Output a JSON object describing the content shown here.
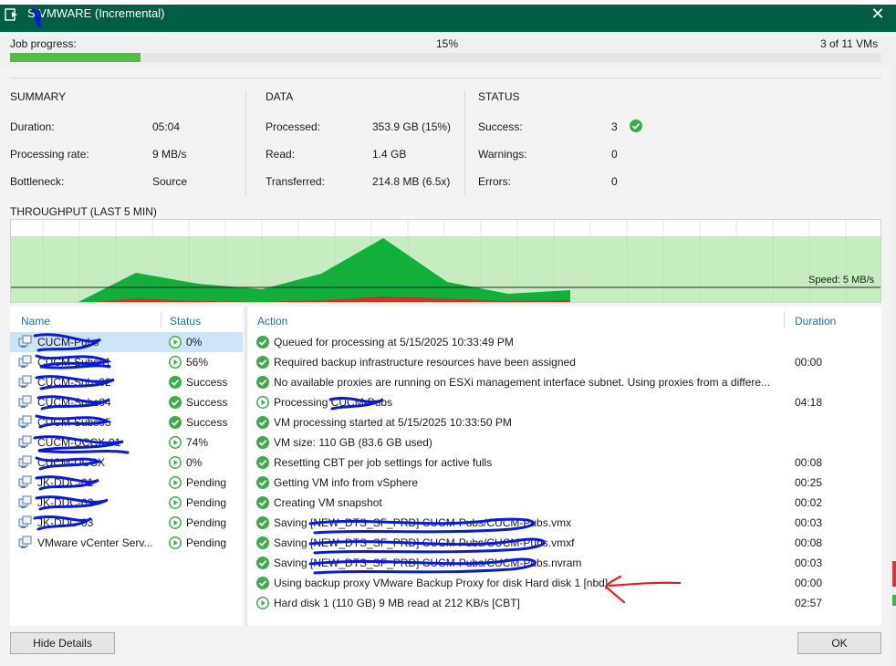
{
  "window": {
    "title": "S.VMWARE (Incremental)",
    "close_label": "✕"
  },
  "progress": {
    "label": "Job progress:",
    "percent_text": "15%",
    "percent_value": 15,
    "vm_count": "3 of 11 VMs"
  },
  "summary": {
    "heading": "SUMMARY",
    "rows": [
      {
        "label": "Duration:",
        "value": "05:04"
      },
      {
        "label": "Processing rate:",
        "value": "9 MB/s"
      },
      {
        "label": "Bottleneck:",
        "value": "Source"
      }
    ]
  },
  "data_section": {
    "heading": "DATA",
    "rows": [
      {
        "label": "Processed:",
        "value": "353.9 GB (15%)"
      },
      {
        "label": "Read:",
        "value": "1.4 GB"
      },
      {
        "label": "Transferred:",
        "value": "214.8 MB (6.5x)"
      }
    ]
  },
  "status_section": {
    "heading": "STATUS",
    "rows": [
      {
        "label": "Success:",
        "value": "3"
      },
      {
        "label": "Warnings:",
        "value": "0"
      },
      {
        "label": "Errors:",
        "value": "0"
      }
    ]
  },
  "throughput": {
    "heading": "THROUGHPUT (LAST 5 MIN)",
    "speed_label": "Speed: 5 MB/s"
  },
  "vm_list": {
    "col_name": "Name",
    "col_status": "Status",
    "rows": [
      {
        "name": "CUCM-Pubs",
        "status": "0%",
        "state": "running",
        "selected": true
      },
      {
        "name": "CUCM-Subs01",
        "status": "56%",
        "state": "running"
      },
      {
        "name": "CUCM-Subs02",
        "status": "Success",
        "state": "ok"
      },
      {
        "name": "CUCM-Subs04",
        "status": "Success",
        "state": "ok"
      },
      {
        "name": "CUCM-Subs05",
        "status": "Success",
        "state": "ok"
      },
      {
        "name": "CUCM-UCCX-01",
        "status": "74%",
        "state": "running"
      },
      {
        "name": "CUCM-UCCX",
        "status": "0%",
        "state": "running"
      },
      {
        "name": "JK-DDC-01",
        "status": "Pending",
        "state": "running"
      },
      {
        "name": "JK-DDC-02",
        "status": "Pending",
        "state": "running"
      },
      {
        "name": "JK-DDC-03",
        "status": "Pending",
        "state": "running"
      },
      {
        "name": "VMware vCenter Serv...",
        "status": "Pending",
        "state": "running"
      }
    ]
  },
  "action_list": {
    "col_action": "Action",
    "col_duration": "Duration",
    "rows": [
      {
        "text": "Queued for processing at 5/15/2025 10:33:49 PM",
        "duration": "",
        "state": "ok"
      },
      {
        "text": "Required backup infrastructure resources have been assigned",
        "duration": "00:00",
        "state": "ok"
      },
      {
        "text": "No available proxies are running on ESXi management interface subnet. Using proxies from a differe...",
        "duration": "",
        "state": "ok"
      },
      {
        "text": "Processing CUCM-Pubs",
        "duration": "04:18",
        "state": "running"
      },
      {
        "text": "VM processing started at 5/15/2025 10:33:50 PM",
        "duration": "",
        "state": "ok"
      },
      {
        "text": "VM size: 110 GB (83.6 GB used)",
        "duration": "",
        "state": "ok"
      },
      {
        "text": "Resetting CBT per job settings for active fulls",
        "duration": "00:08",
        "state": "ok"
      },
      {
        "text": "Getting VM info from vSphere",
        "duration": "00:25",
        "state": "ok"
      },
      {
        "text": "Creating VM snapshot",
        "duration": "00:02",
        "state": "ok"
      },
      {
        "text": "Saving [NEW_DTS_SF_PRD] CUCM-Pubs/CUCM-Pubs.vmx",
        "duration": "00:03",
        "state": "ok"
      },
      {
        "text": "Saving [NEW_DTS_SF_PRD] CUCM-Pubs/CUCM-Pubs.vmxf",
        "duration": "00:08",
        "state": "ok"
      },
      {
        "text": "Saving [NEW_DTS_SF_PRD] CUCM-Pubs/CUCM-Pubs.nvram",
        "duration": "00:03",
        "state": "ok"
      },
      {
        "text": "Using backup proxy VMware Backup Proxy for disk Hard disk 1 [nbd]",
        "duration": "00:00",
        "state": "ok"
      },
      {
        "text": "Hard disk 1 (110 GB) 9 MB read at 212 KB/s [CBT]",
        "duration": "02:57",
        "state": "running"
      }
    ]
  },
  "buttons": {
    "hide_details": "Hide Details",
    "ok": "OK"
  },
  "colors": {
    "titlebar": "#005e45",
    "progress": "#57b84c",
    "chart_fill": "#12b03a",
    "chart_band": "#b5e6ac",
    "chart_red": "#c0392b",
    "link": "#1f6fb2",
    "selection": "#cce4f7",
    "scribble": "#0a1ad6",
    "annotation": "#e02020"
  }
}
